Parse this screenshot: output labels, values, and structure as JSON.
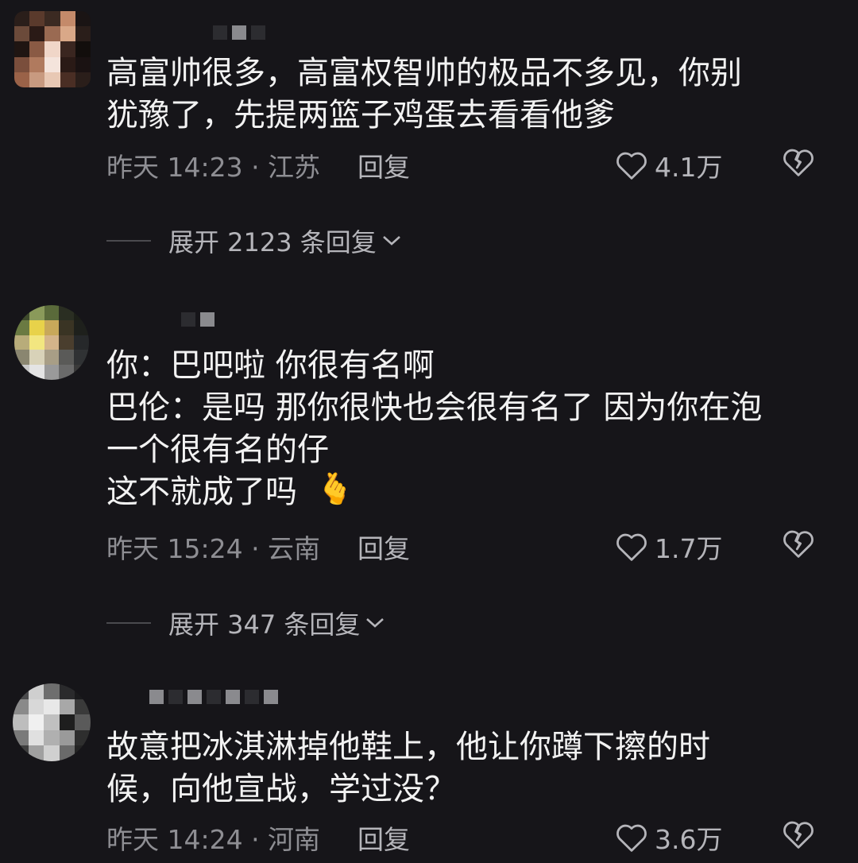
{
  "comments": [
    {
      "text": "高富帅很多，高富权智帅的极品不多见，你别\n犹豫了，先提两篮子鸡蛋去看看他爹",
      "time_location": "昨天 14:23 · 江苏",
      "reply_label": "回复",
      "likes": "4.1万",
      "expand_label": "展开 2123 条回复"
    },
    {
      "text": "你：巴吧啦 你很有名啊\n巴伦：是吗 那你很快也会很有名了 因为你在泡\n一个很有名的仔\n这不就成了吗",
      "emoji": "🫰",
      "time_location": "昨天 15:24 · 云南",
      "reply_label": "回复",
      "likes": "1.7万",
      "expand_label": "展开 347 条回复"
    },
    {
      "text": "故意把冰淇淋掉他鞋上，他让你蹲下擦的时\n候，向他宣战，学过没？",
      "time_location": "昨天 14:24 · 河南",
      "reply_label": "回复",
      "likes": "3.6万"
    }
  ],
  "icons": {
    "like": "heart-outline-icon",
    "dislike": "broken-heart-icon",
    "expand": "chevron-down-icon"
  },
  "colors": {
    "background": "#161519",
    "text": "#f2f2f2",
    "meta": "#8e8e93"
  }
}
